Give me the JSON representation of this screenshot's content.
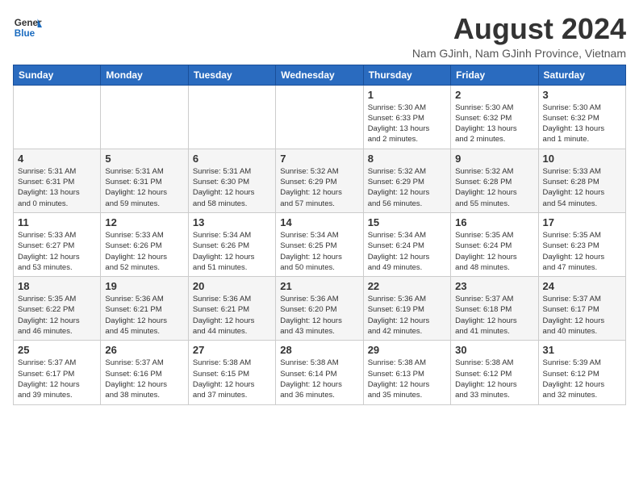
{
  "header": {
    "logo_general": "General",
    "logo_blue": "Blue",
    "month_title": "August 2024",
    "location": "Nam GJinh, Nam GJinh Province, Vietnam"
  },
  "weekdays": [
    "Sunday",
    "Monday",
    "Tuesday",
    "Wednesday",
    "Thursday",
    "Friday",
    "Saturday"
  ],
  "weeks": [
    [
      {
        "day": "",
        "info": ""
      },
      {
        "day": "",
        "info": ""
      },
      {
        "day": "",
        "info": ""
      },
      {
        "day": "",
        "info": ""
      },
      {
        "day": "1",
        "info": "Sunrise: 5:30 AM\nSunset: 6:33 PM\nDaylight: 13 hours\nand 2 minutes."
      },
      {
        "day": "2",
        "info": "Sunrise: 5:30 AM\nSunset: 6:32 PM\nDaylight: 13 hours\nand 2 minutes."
      },
      {
        "day": "3",
        "info": "Sunrise: 5:30 AM\nSunset: 6:32 PM\nDaylight: 13 hours\nand 1 minute."
      }
    ],
    [
      {
        "day": "4",
        "info": "Sunrise: 5:31 AM\nSunset: 6:31 PM\nDaylight: 13 hours\nand 0 minutes."
      },
      {
        "day": "5",
        "info": "Sunrise: 5:31 AM\nSunset: 6:31 PM\nDaylight: 12 hours\nand 59 minutes."
      },
      {
        "day": "6",
        "info": "Sunrise: 5:31 AM\nSunset: 6:30 PM\nDaylight: 12 hours\nand 58 minutes."
      },
      {
        "day": "7",
        "info": "Sunrise: 5:32 AM\nSunset: 6:29 PM\nDaylight: 12 hours\nand 57 minutes."
      },
      {
        "day": "8",
        "info": "Sunrise: 5:32 AM\nSunset: 6:29 PM\nDaylight: 12 hours\nand 56 minutes."
      },
      {
        "day": "9",
        "info": "Sunrise: 5:32 AM\nSunset: 6:28 PM\nDaylight: 12 hours\nand 55 minutes."
      },
      {
        "day": "10",
        "info": "Sunrise: 5:33 AM\nSunset: 6:28 PM\nDaylight: 12 hours\nand 54 minutes."
      }
    ],
    [
      {
        "day": "11",
        "info": "Sunrise: 5:33 AM\nSunset: 6:27 PM\nDaylight: 12 hours\nand 53 minutes."
      },
      {
        "day": "12",
        "info": "Sunrise: 5:33 AM\nSunset: 6:26 PM\nDaylight: 12 hours\nand 52 minutes."
      },
      {
        "day": "13",
        "info": "Sunrise: 5:34 AM\nSunset: 6:26 PM\nDaylight: 12 hours\nand 51 minutes."
      },
      {
        "day": "14",
        "info": "Sunrise: 5:34 AM\nSunset: 6:25 PM\nDaylight: 12 hours\nand 50 minutes."
      },
      {
        "day": "15",
        "info": "Sunrise: 5:34 AM\nSunset: 6:24 PM\nDaylight: 12 hours\nand 49 minutes."
      },
      {
        "day": "16",
        "info": "Sunrise: 5:35 AM\nSunset: 6:24 PM\nDaylight: 12 hours\nand 48 minutes."
      },
      {
        "day": "17",
        "info": "Sunrise: 5:35 AM\nSunset: 6:23 PM\nDaylight: 12 hours\nand 47 minutes."
      }
    ],
    [
      {
        "day": "18",
        "info": "Sunrise: 5:35 AM\nSunset: 6:22 PM\nDaylight: 12 hours\nand 46 minutes."
      },
      {
        "day": "19",
        "info": "Sunrise: 5:36 AM\nSunset: 6:21 PM\nDaylight: 12 hours\nand 45 minutes."
      },
      {
        "day": "20",
        "info": "Sunrise: 5:36 AM\nSunset: 6:21 PM\nDaylight: 12 hours\nand 44 minutes."
      },
      {
        "day": "21",
        "info": "Sunrise: 5:36 AM\nSunset: 6:20 PM\nDaylight: 12 hours\nand 43 minutes."
      },
      {
        "day": "22",
        "info": "Sunrise: 5:36 AM\nSunset: 6:19 PM\nDaylight: 12 hours\nand 42 minutes."
      },
      {
        "day": "23",
        "info": "Sunrise: 5:37 AM\nSunset: 6:18 PM\nDaylight: 12 hours\nand 41 minutes."
      },
      {
        "day": "24",
        "info": "Sunrise: 5:37 AM\nSunset: 6:17 PM\nDaylight: 12 hours\nand 40 minutes."
      }
    ],
    [
      {
        "day": "25",
        "info": "Sunrise: 5:37 AM\nSunset: 6:17 PM\nDaylight: 12 hours\nand 39 minutes."
      },
      {
        "day": "26",
        "info": "Sunrise: 5:37 AM\nSunset: 6:16 PM\nDaylight: 12 hours\nand 38 minutes."
      },
      {
        "day": "27",
        "info": "Sunrise: 5:38 AM\nSunset: 6:15 PM\nDaylight: 12 hours\nand 37 minutes."
      },
      {
        "day": "28",
        "info": "Sunrise: 5:38 AM\nSunset: 6:14 PM\nDaylight: 12 hours\nand 36 minutes."
      },
      {
        "day": "29",
        "info": "Sunrise: 5:38 AM\nSunset: 6:13 PM\nDaylight: 12 hours\nand 35 minutes."
      },
      {
        "day": "30",
        "info": "Sunrise: 5:38 AM\nSunset: 6:12 PM\nDaylight: 12 hours\nand 33 minutes."
      },
      {
        "day": "31",
        "info": "Sunrise: 5:39 AM\nSunset: 6:12 PM\nDaylight: 12 hours\nand 32 minutes."
      }
    ]
  ]
}
